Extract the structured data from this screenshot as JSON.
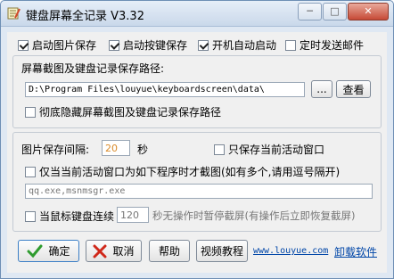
{
  "window": {
    "title": "键盘屏幕全记录 V3.32",
    "min_label": "─",
    "max_label": "□",
    "close_label": "✕"
  },
  "options": {
    "start_image_save": "启动图片保存",
    "start_key_save": "启动按键保存",
    "autostart": "开机自动启动",
    "timed_email": "定时发送邮件"
  },
  "path_section": {
    "label": "屏幕截图及键盘记录保存路径:",
    "path_value": "D:\\Program Files\\louyue\\keyboardscreen\\data\\",
    "browse_label": "...",
    "view_label": "查看",
    "hide_path_label": "彻底隐藏屏幕截图及键盘记录保存路径"
  },
  "capture_section": {
    "interval_label": "图片保存间隔:",
    "interval_value": "20",
    "interval_unit": "秒",
    "only_active_label": "只保存当前活动窗口",
    "only_programs_label": "仅当当前活动窗口为如下程序时才截图(如有多个,请用逗号隔开)",
    "programs_value": "qq.exe,msnmsgr.exe",
    "pause_label": "当鼠标键盘连续",
    "pause_value": "120",
    "pause_suffix": "秒无操作时暂停截屏(有操作后立即恢复截屏)"
  },
  "buttons": {
    "ok": "确定",
    "cancel": "取消",
    "help": "帮助",
    "video": "视频教程"
  },
  "links": {
    "website": "www.louyue.com",
    "uninstall": "卸载软件"
  },
  "colors": {
    "ok_icon": "#2e9b2e",
    "cancel_icon": "#d0281a",
    "link": "#0046a8"
  }
}
